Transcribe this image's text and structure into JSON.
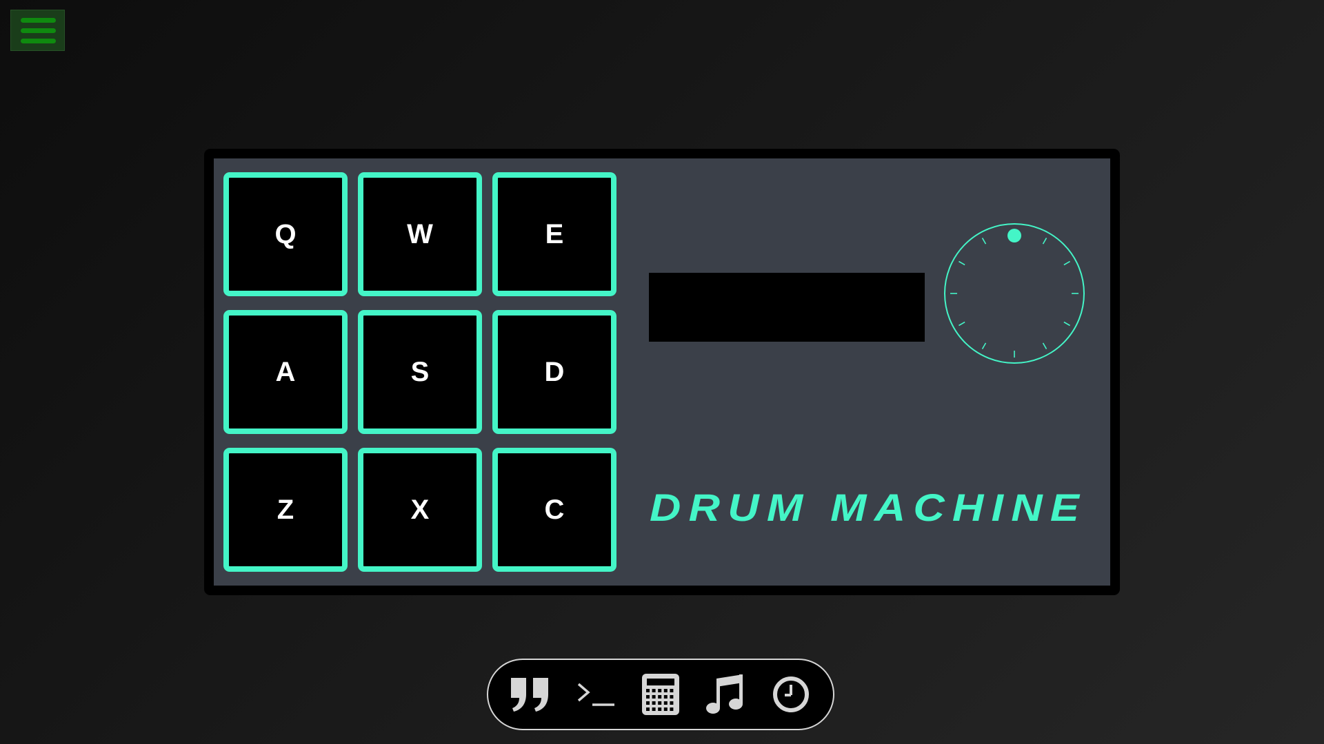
{
  "menu": {
    "icon": "hamburger-menu-icon"
  },
  "pads": [
    {
      "key": "Q"
    },
    {
      "key": "W"
    },
    {
      "key": "E"
    },
    {
      "key": "A"
    },
    {
      "key": "S"
    },
    {
      "key": "D"
    },
    {
      "key": "Z"
    },
    {
      "key": "X"
    },
    {
      "key": "C"
    }
  ],
  "display": {
    "text": ""
  },
  "volume_knob": {
    "icon": "volume-knob-icon"
  },
  "title": "DRUM MACHINE",
  "dock": [
    {
      "icon": "quote-icon",
      "name": "quote"
    },
    {
      "icon": "terminal-icon",
      "name": "terminal"
    },
    {
      "icon": "calculator-icon",
      "name": "calculator"
    },
    {
      "icon": "music-note-icon",
      "name": "drum-machine"
    },
    {
      "icon": "clock-icon",
      "name": "clock"
    }
  ],
  "colors": {
    "accent": "#44f5c7",
    "panel": "#3b4049",
    "menu_bar": "#0f8a0f",
    "dock_icon": "#d6d6d6"
  }
}
